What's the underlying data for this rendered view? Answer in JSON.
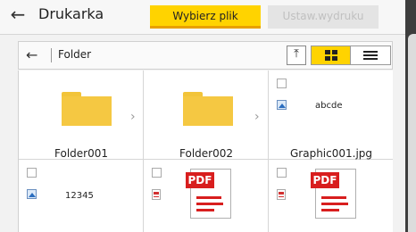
{
  "header": {
    "title": "Drukarka",
    "tabs": [
      {
        "label": "Wybierz plik",
        "state": "active"
      },
      {
        "label": "Ustaw.wydruku",
        "state": "disabled"
      }
    ]
  },
  "folder_bar": {
    "path": "Folder"
  },
  "view_mode": "grid",
  "items": [
    {
      "name": "Folder001",
      "type": "folder"
    },
    {
      "name": "Folder002",
      "type": "folder"
    },
    {
      "name": "Graphic001.jpg",
      "type": "image",
      "preview_text": "abcde"
    },
    {
      "name": "",
      "type": "image",
      "preview_text": "12345"
    },
    {
      "name": "",
      "type": "pdf"
    },
    {
      "name": "",
      "type": "pdf"
    }
  ],
  "badges": {
    "pdf": "PDF"
  },
  "colors": {
    "accent": "#ffd300",
    "accent_border": "#e8a000",
    "pdf_red": "#d81e1e",
    "folder": "#f5c842"
  }
}
